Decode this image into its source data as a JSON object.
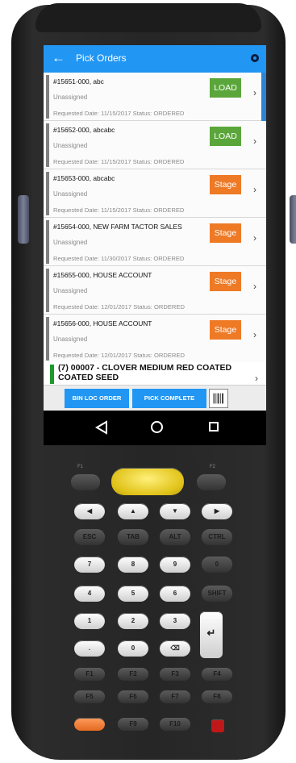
{
  "app": {
    "title": "Pick Orders",
    "accent_color": "#2196f3",
    "back_icon": "arrow-left-icon",
    "settings_icon": "gear-icon"
  },
  "orders": [
    {
      "name": "#15651-000, abc",
      "assignee": "Unassigned",
      "meta": "Requested Date: 11/15/2017  Status: ORDERED",
      "action": "LOAD"
    },
    {
      "name": "#15652-000, abcabc",
      "assignee": "Unassigned",
      "meta": "Requested Date: 11/15/2017  Status: ORDERED",
      "action": "LOAD"
    },
    {
      "name": "#15653-000, abcabc",
      "assignee": "Unassigned",
      "meta": "Requested Date: 11/15/2017  Status: ORDERED",
      "action": "Stage"
    },
    {
      "name": "#15654-000, NEW FARM TACTOR SALES",
      "assignee": "Unassigned",
      "meta": "Requested Date: 11/30/2017  Status: ORDERED",
      "action": "Stage"
    },
    {
      "name": "#15655-000, HOUSE ACCOUNT",
      "assignee": "Unassigned",
      "meta": "Requested Date: 12/01/2017  Status: ORDERED",
      "action": "Stage"
    },
    {
      "name": "#15656-000, HOUSE ACCOUNT",
      "assignee": "Unassigned",
      "meta": "Requested Date: 12/01/2017  Status: ORDERED",
      "action": "Stage"
    }
  ],
  "item_row": {
    "text": "(7) 00007 - CLOVER MEDIUM RED COATED COATED SEED"
  },
  "bottom_bar": {
    "bin_loc_label": "BIN LOC ORDER",
    "pick_complete_label": "PICK COMPLETE",
    "barcode_icon": "barcode-icon"
  },
  "keypad": {
    "f1": "F1",
    "f2": "F2",
    "arrows": [
      "◀",
      "▲",
      "▼",
      "▶"
    ],
    "row_mod": [
      "ESC",
      "TAB",
      "ALT",
      "CTRL"
    ],
    "row1": [
      "7",
      "8",
      "9",
      "0"
    ],
    "row2": [
      "4",
      "5",
      "6",
      "SHIFT"
    ],
    "row3": [
      "1",
      "2",
      "3"
    ],
    "row4": [
      ".",
      "0",
      "⌫"
    ],
    "row_f1": [
      "F1",
      "F2",
      "F3",
      "F4"
    ],
    "row_f2": [
      "F5",
      "F6",
      "F7",
      "F8"
    ],
    "row_f3": [
      "",
      "F9",
      "F10",
      ""
    ],
    "enter": "↵"
  },
  "colors": {
    "load_button": "#5aa63a",
    "stage_button": "#ee7a26",
    "scan_key": "#f2d321"
  }
}
